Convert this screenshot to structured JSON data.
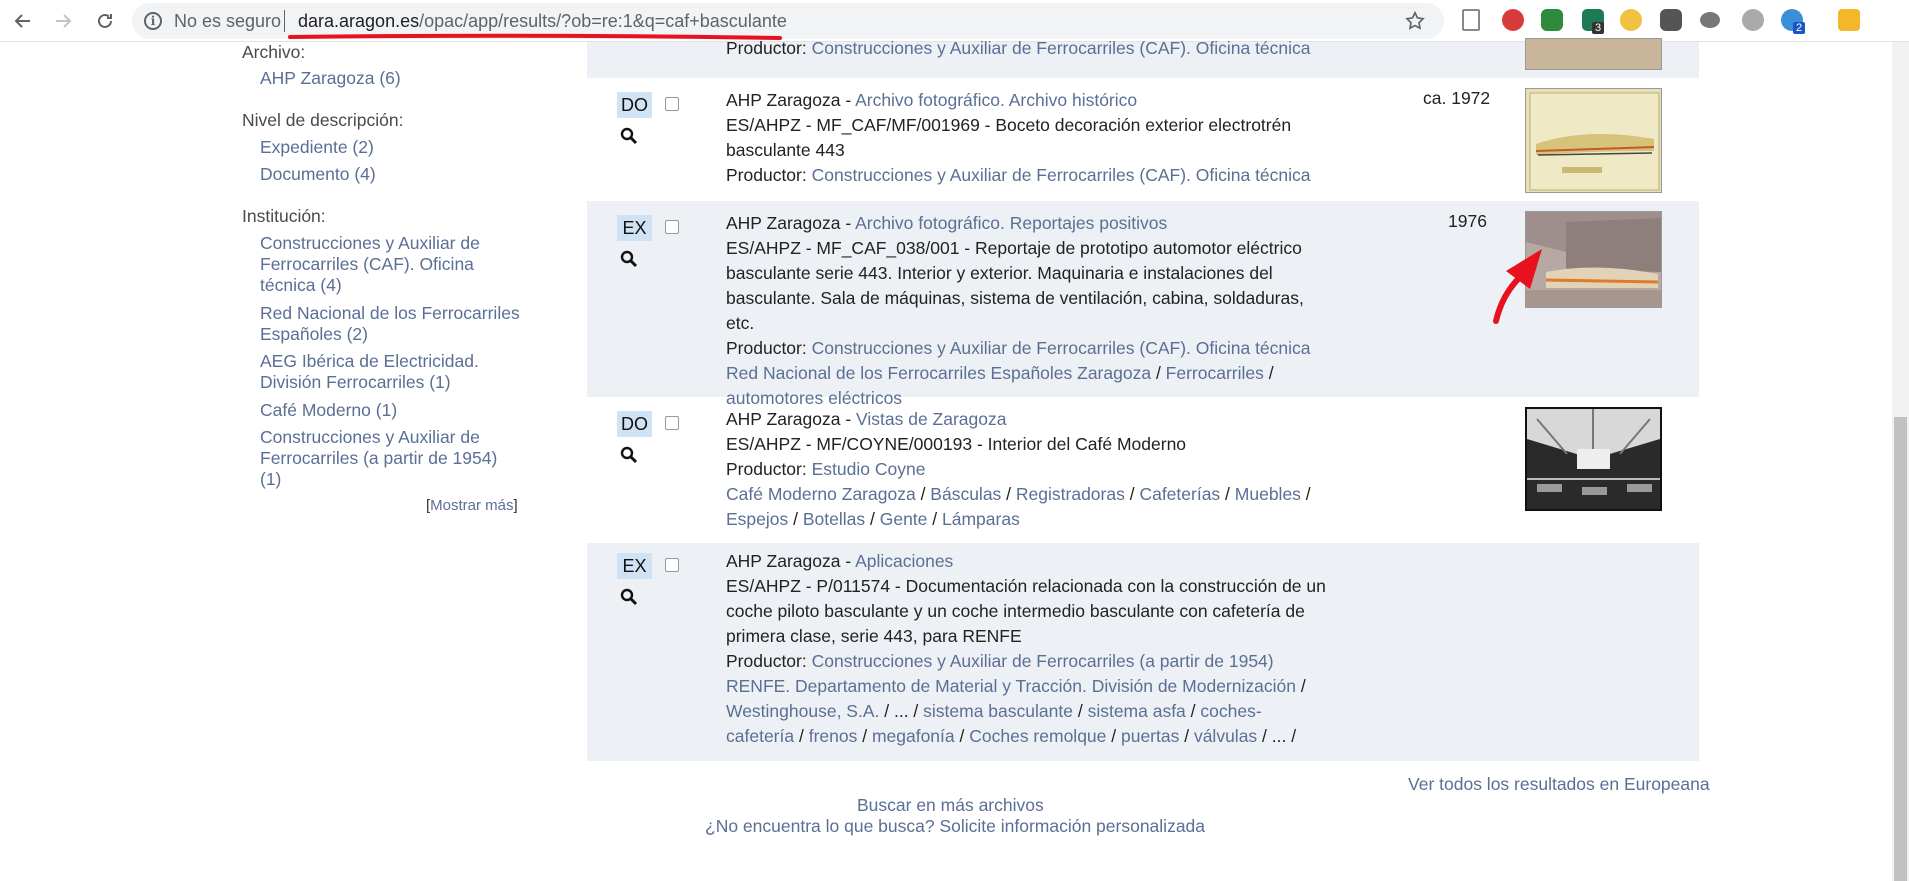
{
  "browser": {
    "security_label": "No es seguro",
    "url_host": "dara.aragon.es",
    "url_path": "/opac/app/results/?ob=re:1&q=caf+basculante",
    "badges": {
      "ext_3": "3",
      "ext_9": "2"
    }
  },
  "sidebar": {
    "archivo_title": "Archivo:",
    "archivo_items": [
      "AHP Zaragoza (6)"
    ],
    "nivel_title": "Nivel de descripción:",
    "nivel_items": [
      "Expediente (2)",
      "Documento (4)"
    ],
    "institucion_title": "Institución:",
    "institucion_items": [
      "Construcciones y Auxiliar de Ferrocarriles (CAF). Oficina técnica (4)",
      "Red Nacional de los Ferrocarriles Españoles (2)",
      "AEG Ibérica de Electricidad. División Ferrocarriles (1)",
      "Café Moderno (1)",
      "Construcciones y Auxiliar de Ferrocarriles (a partir de 1954) (1)"
    ],
    "mostrar_mas": "Mostrar más"
  },
  "results": {
    "r0": {
      "productor_label": "Productor:",
      "productor": "Construcciones y Auxiliar de Ferrocarriles (CAF). Oficina técnica"
    },
    "r1": {
      "type": "DO",
      "archive": "AHP Zaragoza",
      "series": "Archivo fotográfico. Archivo histórico",
      "code_title": "ES/AHPZ - MF_CAF/MF/001969 - Boceto decoración exterior electrotrén basculante 443",
      "productor_label": "Productor:",
      "productor": "Construcciones y Auxiliar de Ferrocarriles (CAF). Oficina técnica",
      "date": "ca. 1972"
    },
    "r2": {
      "type": "EX",
      "archive": "AHP Zaragoza",
      "series": "Archivo fotográfico. Reportajes positivos",
      "code_title": "ES/AHPZ - MF_CAF_038/001 - Reportaje de prototipo automotor eléctrico basculante serie 443. Interior y exterior. Maquinaria e instalaciones del basculante. Sala de máquinas, sistema de ventilación, cabina, soldaduras, etc.",
      "productor_label": "Productor:",
      "productor": "Construcciones y Auxiliar de Ferrocarriles (CAF). Oficina técnica",
      "tags": [
        "Red Nacional de los Ferrocarriles Españoles Zaragoza",
        "Ferrocarriles",
        "automotores eléctricos"
      ],
      "date": "1976"
    },
    "r3": {
      "type": "DO",
      "archive": "AHP Zaragoza",
      "series": "Vistas de Zaragoza",
      "code_title": "ES/AHPZ - MF/COYNE/000193 - Interior del Café Moderno",
      "productor_label": "Productor:",
      "productor": "Estudio Coyne",
      "tags": [
        "Café Moderno Zaragoza",
        "Básculas",
        "Registradoras",
        "Cafeterías",
        "Muebles",
        "Espejos",
        "Botellas",
        "Gente",
        "Lámparas"
      ]
    },
    "r4": {
      "type": "EX",
      "archive": "AHP Zaragoza",
      "series": "Aplicaciones",
      "code_title": "ES/AHPZ - P/011574 - Documentación relacionada con la construcción de un coche piloto basculante y un coche intermedio basculante con cafetería de primera clase, serie 443, para RENFE",
      "productor_label": "Productor:",
      "productor": "Construcciones y Auxiliar de Ferrocarriles (a partir de 1954)",
      "tags": [
        "RENFE. Departamento de Material y Tracción. División de Modernización",
        "Westinghouse, S.A.",
        "...",
        "sistema basculante",
        "sistema asfa",
        "coches-cafetería",
        "frenos",
        "megafonía",
        "Coches remolque",
        "puertas",
        "válvulas",
        "..."
      ]
    }
  },
  "separators": {
    "dash": " - ",
    "slash": " / "
  },
  "footer": {
    "europeana": "Ver todos los resultados en Europeana",
    "buscar": "Buscar en más archivos",
    "no_encuentra": "¿No encuentra lo que busca? Solicite información personalizada"
  },
  "colors": {
    "link": "#5b6f94",
    "badge_bg": "#cfe3f5",
    "row_shade": "#edf1f6",
    "annotation": "#e8121e"
  }
}
